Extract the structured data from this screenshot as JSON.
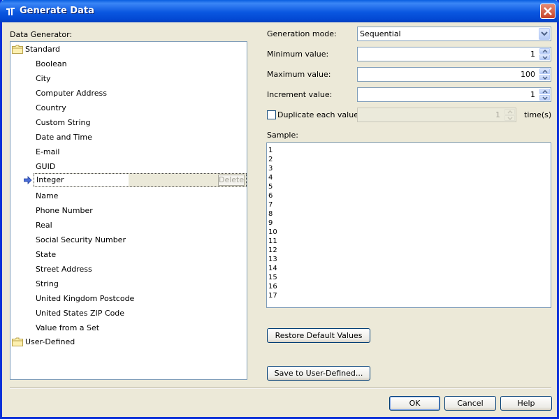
{
  "window": {
    "title": "Generate Data"
  },
  "left": {
    "label": "Data Generator:",
    "folders": {
      "standard": "Standard",
      "user_defined": "User-Defined"
    },
    "items": [
      "Boolean",
      "City",
      "Computer Address",
      "Country",
      "Custom String",
      "Date and Time",
      "E-mail",
      "GUID",
      "Integer",
      "Name",
      "Phone Number",
      "Real",
      "Social Security Number",
      "State",
      "Street Address",
      "String",
      "United Kingdom Postcode",
      "United States ZIP Code",
      "Value from a Set"
    ],
    "selected_index": 8,
    "delete_label": "Delete"
  },
  "form": {
    "generation_mode_label": "Generation mode:",
    "generation_mode_value": "Sequential",
    "minimum_label": "Minimum value:",
    "minimum_value": "1",
    "maximum_label": "Maximum value:",
    "maximum_value": "100",
    "increment_label": "Increment value:",
    "increment_value": "1",
    "duplicate_label": "Duplicate each value",
    "duplicate_value": "1",
    "duplicate_checked": false,
    "times_label": "time(s)",
    "sample_label": "Sample:",
    "sample_values": [
      "1",
      "2",
      "3",
      "4",
      "5",
      "6",
      "7",
      "8",
      "9",
      "10",
      "11",
      "12",
      "13",
      "14",
      "15",
      "16",
      "17"
    ]
  },
  "buttons": {
    "restore": "Restore Default Values",
    "save_user_defined": "Save to User-Defined...",
    "ok": "OK",
    "cancel": "Cancel",
    "help": "Help"
  },
  "colors": {
    "title_bar": "#0a57e0",
    "dialog_bg": "#ece9d8",
    "close": "#c6432a"
  }
}
